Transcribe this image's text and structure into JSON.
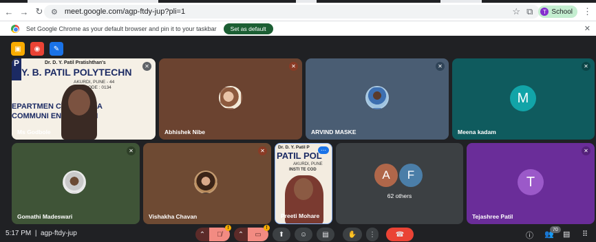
{
  "browser": {
    "url": "meet.google.com/agp-ftdy-jup?pli=1",
    "profile_label": "School",
    "profile_initial": "T"
  },
  "infobar": {
    "message": "Set Google Chrome as your default browser and pin it to your taskbar",
    "button_label": "Set as default"
  },
  "tiles": [
    {
      "name": "Godbole",
      "name_prefix": "M",
      "type": "presenter"
    },
    {
      "name": "Abhishek Nibe",
      "type": "photo"
    },
    {
      "name": "ARVIND MASKE",
      "type": "photo"
    },
    {
      "name": "Meena kadam",
      "type": "letter",
      "letter": "M"
    },
    {
      "name": "Gomathi Madeswari",
      "type": "photo"
    },
    {
      "name": "Vishakha Chavan",
      "type": "photo"
    },
    {
      "name": "Preeti Mohare",
      "type": "presenter-small"
    },
    {
      "name": "62 others",
      "type": "group",
      "letters": [
        "A",
        "F"
      ]
    },
    {
      "name": "Tejashree Patil",
      "type": "letter",
      "letter": "T"
    }
  ],
  "banner": {
    "line1": "Dr. D. Y. Patil Pratishthan's",
    "line2": "Y. B. PATIL POLYTECHN",
    "line3": "AKURDI, PUNE - 44",
    "line4": "E CODE : 0134",
    "line5": "EPARTMEN      CTRONICS A",
    "line6": "COMMUNI       ENGINEERIN",
    "block_letter": "P"
  },
  "banner_small": {
    "line1": "Dr. D. Y. Patil P",
    "line2": "PATIL POL",
    "line3": "AKURDI, PUNE",
    "line4": "INSTI   TE COD"
  },
  "bottom": {
    "time": "5:17 PM",
    "separator": "|",
    "meeting_code": "agp-ftdy-jup",
    "participants_count": "70"
  },
  "colors": {
    "meet_bg": "#202124",
    "hangup_red": "#ea4335",
    "set_default_green": "#1b5e33"
  }
}
